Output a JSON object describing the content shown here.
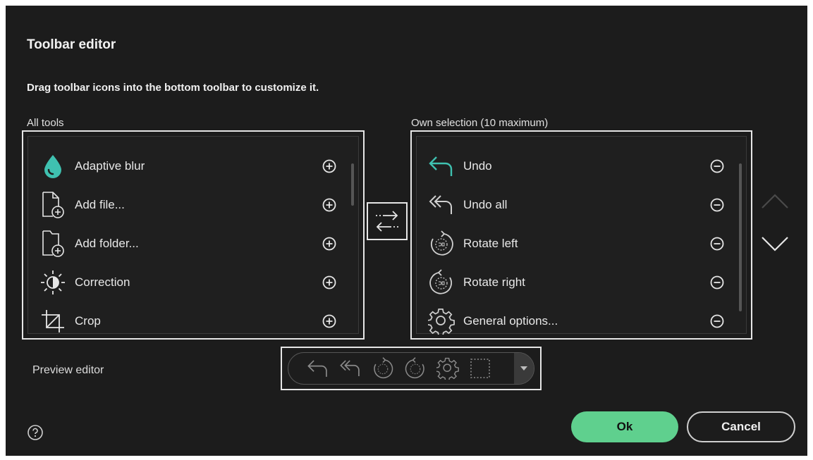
{
  "dialog": {
    "title": "Toolbar editor",
    "subtitle": "Drag toolbar icons into the bottom toolbar to customize it."
  },
  "all_tools": {
    "label": "All tools",
    "items": [
      {
        "label": "Adaptive blur",
        "icon": "drop-icon",
        "action": "add-icon"
      },
      {
        "label": "Add file...",
        "icon": "add-file-icon",
        "action": "add-icon"
      },
      {
        "label": "Add folder...",
        "icon": "add-folder-icon",
        "action": "add-icon"
      },
      {
        "label": "Correction",
        "icon": "brightness-icon",
        "action": "add-icon"
      },
      {
        "label": "Crop",
        "icon": "crop-icon",
        "action": "add-icon"
      }
    ]
  },
  "own_selection": {
    "label": "Own selection (10 maximum)",
    "items": [
      {
        "label": "Undo",
        "icon": "undo-icon",
        "action": "remove-icon"
      },
      {
        "label": "Undo all",
        "icon": "undo-all-icon",
        "action": "remove-icon"
      },
      {
        "label": "Rotate left",
        "icon": "rotate-left-icon",
        "action": "remove-icon"
      },
      {
        "label": "Rotate right",
        "icon": "rotate-right-icon",
        "action": "remove-icon"
      },
      {
        "label": "General options...",
        "icon": "gear-icon",
        "action": "remove-icon"
      }
    ]
  },
  "preview": {
    "label": "Preview editor",
    "icons": [
      "undo-icon",
      "undo-all-icon",
      "rotate-left-icon",
      "rotate-right-icon",
      "gear-icon",
      "selection-icon"
    ]
  },
  "buttons": {
    "ok": "Ok",
    "cancel": "Cancel"
  },
  "colors": {
    "background": "#1c1c1c",
    "accent": "#5fd08e",
    "teal": "#3fc1b0"
  }
}
